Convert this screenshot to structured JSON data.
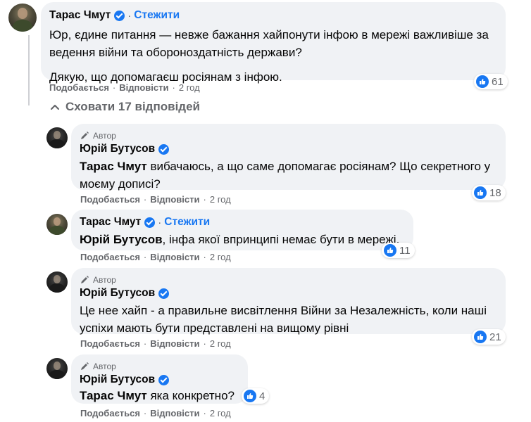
{
  "comments": [
    {
      "author": "Тарас Чмут",
      "follow": "Стежити",
      "paragraphs": [
        "Юр, єдине питання — невже бажання хайпонути інфою в мережі важливіше за ведення війни та обороноздатність держави?",
        "Дякую, що допомагаєш росіянам з інфою."
      ],
      "actions": {
        "like": "Подобається",
        "reply": "Відповісти",
        "time": "2 год"
      },
      "reactions": "61"
    }
  ],
  "toggle_label": "Сховати 17 відповідей",
  "replies": [
    {
      "badge": "Автор",
      "author": "Юрій Бутусов",
      "mention": "Тарас Чмут",
      "text": " вибачаюсь, а що саме допомагає росіянам? Що секретного у моєму дописі?",
      "actions": {
        "like": "Подобається",
        "reply": "Відповісти",
        "time": "2 год"
      },
      "reactions": "18"
    },
    {
      "author": "Тарас Чмут",
      "follow": "Стежити",
      "mention": "Юрій Бутусов",
      "text": ", інфа якої впринципі немає бути в мережі.",
      "actions": {
        "like": "Подобається",
        "reply": "Відповісти",
        "time": "2 год"
      },
      "reactions": "11"
    },
    {
      "badge": "Автор",
      "author": "Юрій Бутусов",
      "text": "Це нее хайп - а правильне висвітлення Війни за Незалежність, коли наші успіхи мають бути представлені на вищому рівні",
      "actions": {
        "like": "Подобається",
        "reply": "Відповісти",
        "time": "2 год"
      },
      "reactions": "21"
    },
    {
      "badge": "Автор",
      "author": "Юрій Бутусов",
      "mention": "Тарас Чмут",
      "text": " яка конкретно?",
      "actions": {
        "like": "Подобається",
        "reply": "Відповісти",
        "time": "2 год"
      },
      "reactions": "4"
    }
  ],
  "colors": {
    "accent": "#1877f2",
    "bubble": "#f0f2f5",
    "muted": "#65676b"
  },
  "icons": {
    "verified": "verified-badge-icon",
    "like": "like-thumb-icon",
    "pen": "pen-icon",
    "chevron": "chevron-up-icon"
  }
}
